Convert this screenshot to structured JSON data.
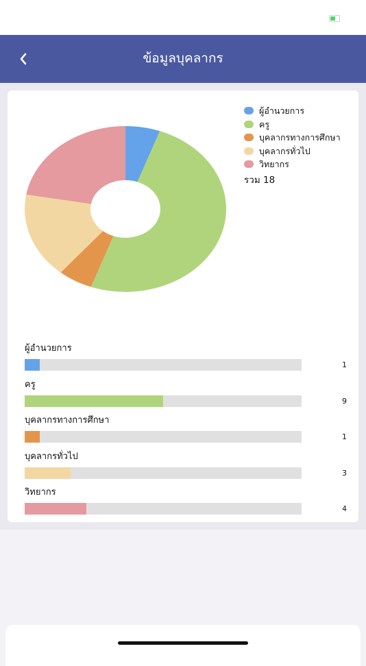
{
  "header": {
    "title": "ข้อมูลบุคลากร"
  },
  "battery_level": 0.55,
  "chart_data": {
    "type": "pie",
    "categories": [
      "ผู้อำนวยการ",
      "ครู",
      "บุคลากรทางการศึกษา",
      "บุคลากรทั่วไป",
      "วิทยากร"
    ],
    "values": [
      1,
      9,
      1,
      3,
      4
    ],
    "colors": [
      "#64a3ea",
      "#b0d47c",
      "#e3954c",
      "#f3d7a3",
      "#e49a9f"
    ],
    "total_label": "รวม 18",
    "bar_max": 18,
    "legend_position": "right"
  },
  "colors": {
    "nav": "#4a58a0",
    "track": "#e0e0e0"
  }
}
